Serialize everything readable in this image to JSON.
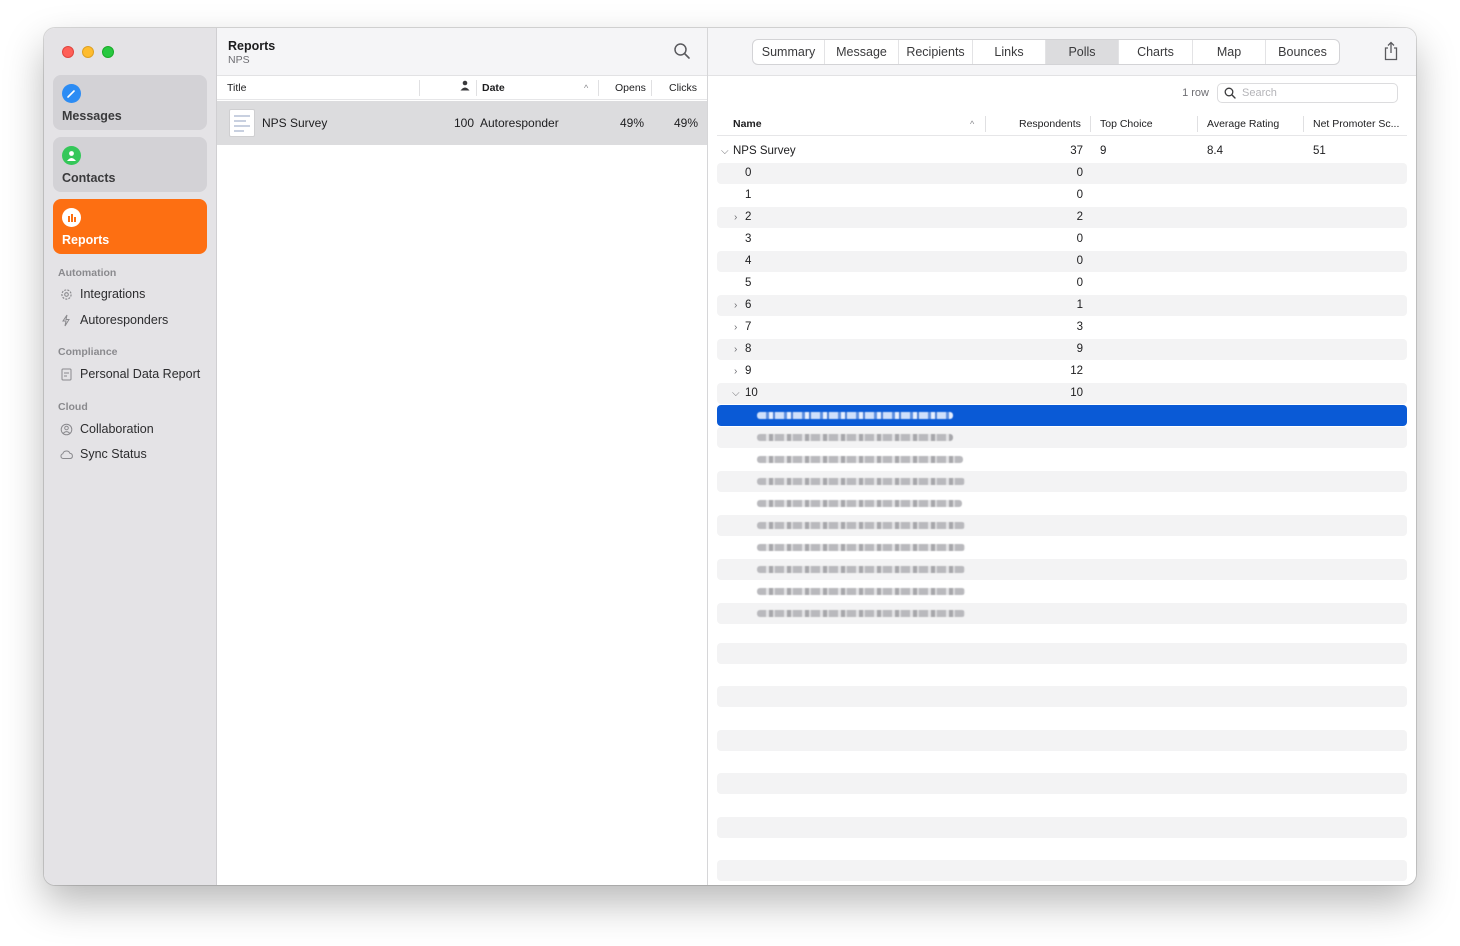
{
  "sidebar": {
    "tiles": [
      {
        "label": "Messages",
        "icon": "compose-icon",
        "color": "#2c8cf4",
        "active": false
      },
      {
        "label": "Contacts",
        "icon": "person-icon",
        "color": "#34c759",
        "active": false
      },
      {
        "label": "Reports",
        "icon": "chart-icon",
        "color": "#ffffff",
        "active": true
      }
    ],
    "sections": [
      {
        "title": "Automation",
        "items": [
          {
            "label": "Integrations",
            "icon": "gear-icon"
          },
          {
            "label": "Autoresponders",
            "icon": "bolt-icon"
          }
        ]
      },
      {
        "title": "Compliance",
        "items": [
          {
            "label": "Personal Data Report",
            "icon": "document-icon"
          }
        ]
      },
      {
        "title": "Cloud",
        "items": [
          {
            "label": "Collaboration",
            "icon": "person-circle-icon"
          },
          {
            "label": "Sync Status",
            "icon": "cloud-icon"
          }
        ]
      }
    ],
    "accent": "#fd6f12"
  },
  "middle": {
    "title": "Reports",
    "subtitle": "NPS",
    "columns": {
      "title": "Title",
      "date": "Date",
      "opens": "Opens",
      "clicks": "Clicks"
    },
    "rows": [
      {
        "title": "NPS Survey",
        "recipients": "100",
        "date": "Autoresponder",
        "opens": "49%",
        "clicks": "49%"
      }
    ]
  },
  "right": {
    "tabs": [
      "Summary",
      "Message",
      "Recipients",
      "Links",
      "Polls",
      "Charts",
      "Map",
      "Bounces"
    ],
    "selected_tab": "Polls",
    "row_count": "1 row",
    "search_placeholder": "Search",
    "columns": {
      "name": "Name",
      "respondents": "Respondents",
      "top_choice": "Top Choice",
      "average_rating": "Average Rating",
      "nps": "Net Promoter Sc..."
    },
    "poll": {
      "name": "NPS Survey",
      "respondents": "37",
      "top_choice": "9",
      "average_rating": "8.4",
      "nps": "51"
    },
    "choices": [
      {
        "label": "0",
        "count": "0",
        "expandable": false,
        "expanded": false
      },
      {
        "label": "1",
        "count": "0",
        "expandable": false,
        "expanded": false
      },
      {
        "label": "2",
        "count": "2",
        "expandable": true,
        "expanded": false
      },
      {
        "label": "3",
        "count": "0",
        "expandable": false,
        "expanded": false
      },
      {
        "label": "4",
        "count": "0",
        "expandable": false,
        "expanded": false
      },
      {
        "label": "5",
        "count": "0",
        "expandable": false,
        "expanded": false
      },
      {
        "label": "6",
        "count": "1",
        "expandable": true,
        "expanded": false
      },
      {
        "label": "7",
        "count": "3",
        "expandable": true,
        "expanded": false
      },
      {
        "label": "8",
        "count": "9",
        "expandable": true,
        "expanded": false
      },
      {
        "label": "9",
        "count": "12",
        "expandable": true,
        "expanded": false
      },
      {
        "label": "10",
        "count": "10",
        "expandable": true,
        "expanded": true
      }
    ],
    "respondent_count": 10,
    "selection_color": "#0a5ad6"
  }
}
